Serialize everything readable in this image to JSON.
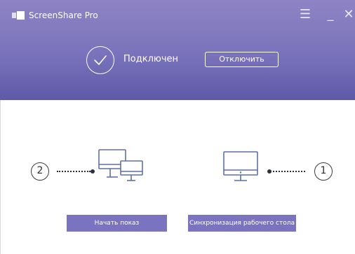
{
  "app": {
    "title": "ScreenShare Pro",
    "colors": {
      "header_top": "#8e84c4",
      "header_bottom": "#5e5aa8",
      "accent": "#7b73bf"
    }
  },
  "window_controls": {
    "menu": "☰",
    "minimize": "_",
    "close": "✕"
  },
  "status": {
    "text": "Подключен",
    "icon": "checkmark-icon",
    "disconnect_label": "Отключить"
  },
  "steps": [
    {
      "number": "2",
      "icon": "devices-icon"
    },
    {
      "number": "1",
      "icon": "desktop-monitor-icon"
    }
  ],
  "actions": {
    "start_label": "Начать показ",
    "sync_label": "Синхронизация рабочего стола"
  }
}
